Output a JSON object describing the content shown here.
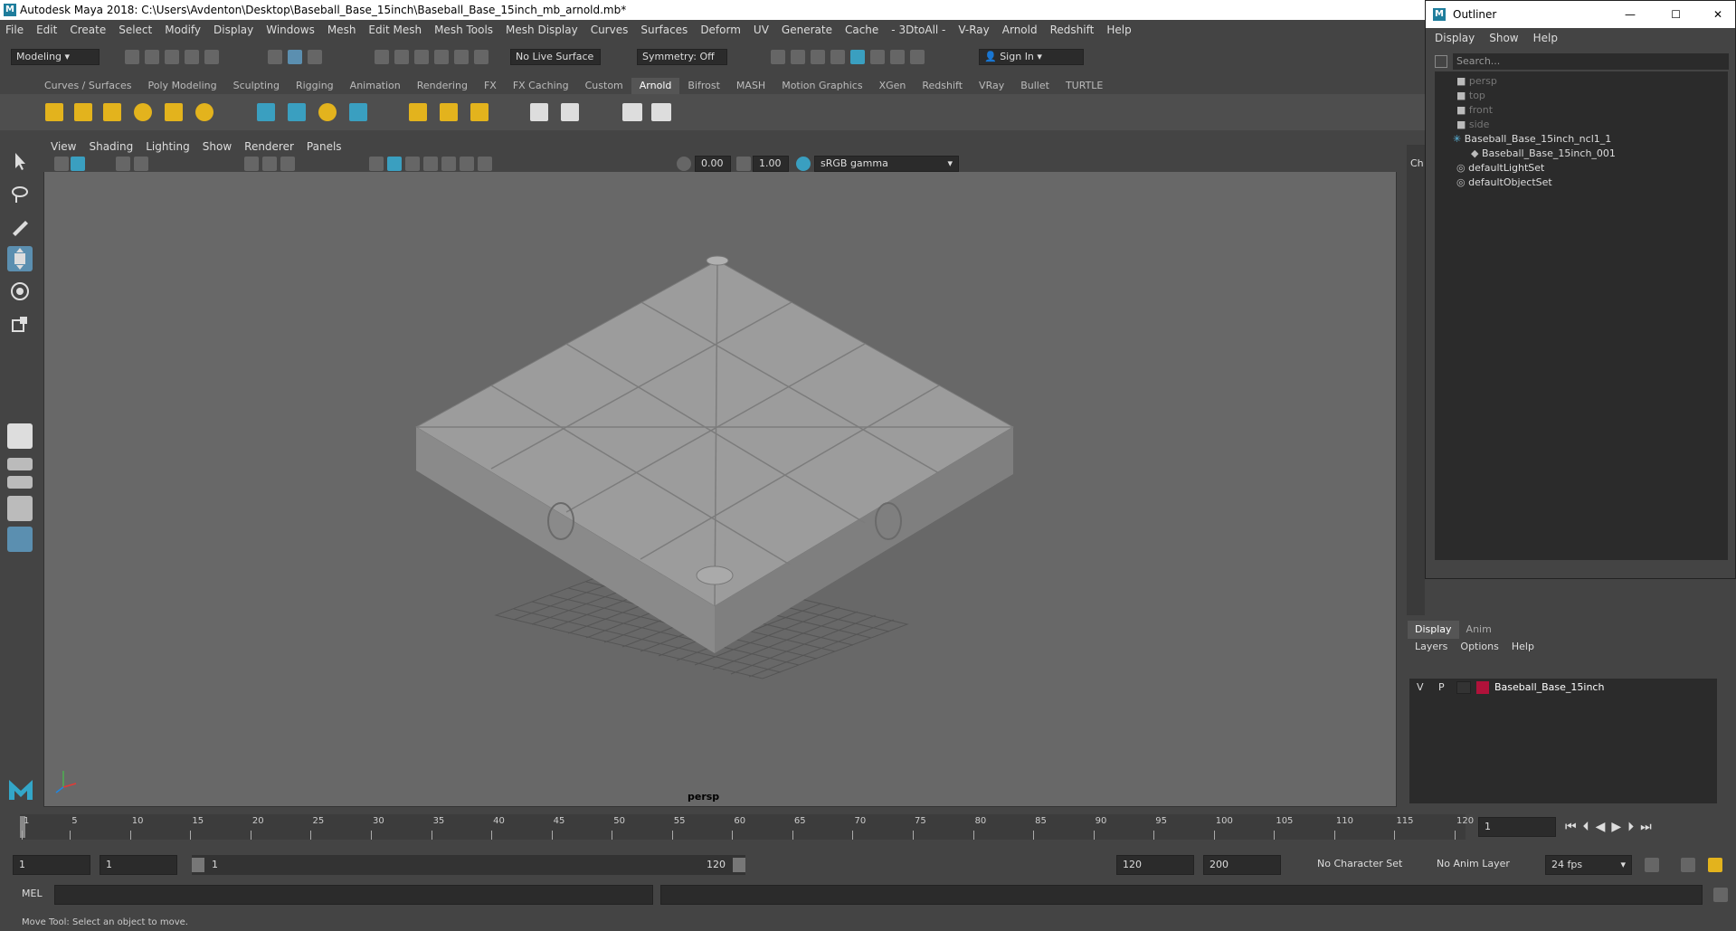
{
  "window": {
    "title": "Autodesk Maya 2018: C:\\Users\\Avdenton\\Desktop\\Baseball_Base_15inch\\Baseball_Base_15inch_mb_arnold.mb*"
  },
  "menu": [
    "File",
    "Edit",
    "Create",
    "Select",
    "Modify",
    "Display",
    "Windows",
    "Mesh",
    "Edit Mesh",
    "Mesh Tools",
    "Mesh Display",
    "Curves",
    "Surfaces",
    "Deform",
    "UV",
    "Generate",
    "Cache",
    "- 3DtoAll -",
    "V-Ray",
    "Arnold",
    "Redshift",
    "Help"
  ],
  "status": {
    "mode": "Modeling",
    "live_surface": "No Live Surface",
    "symmetry": "Symmetry: Off",
    "sign_in": "Sign In"
  },
  "shelf_tabs": [
    "Curves / Surfaces",
    "Poly Modeling",
    "Sculpting",
    "Rigging",
    "Animation",
    "Rendering",
    "FX",
    "FX Caching",
    "Custom",
    "Arnold",
    "Bifrost",
    "MASH",
    "Motion Graphics",
    "XGen",
    "Redshift",
    "VRay",
    "Bullet",
    "TURTLE"
  ],
  "shelf_active": "Arnold",
  "viewport": {
    "menu": [
      "View",
      "Shading",
      "Lighting",
      "Show",
      "Renderer",
      "Panels"
    ],
    "exposure": "0.00",
    "gamma": "1.00",
    "color_space": "sRGB gamma",
    "camera": "persp"
  },
  "outliner": {
    "title": "Outliner",
    "menu": [
      "Display",
      "Show",
      "Help"
    ],
    "search_placeholder": "Search...",
    "items": [
      {
        "label": "persp",
        "dim": true
      },
      {
        "label": "top",
        "dim": true
      },
      {
        "label": "front",
        "dim": true
      },
      {
        "label": "side",
        "dim": true
      },
      {
        "label": "Baseball_Base_15inch_ncl1_1",
        "dim": false
      },
      {
        "label": "Baseball_Base_15inch_001",
        "dim": false
      },
      {
        "label": "defaultLightSet",
        "dim": false
      },
      {
        "label": "defaultObjectSet",
        "dim": false
      }
    ]
  },
  "channel_box_tab": "Ch",
  "layer_editor": {
    "tabs": [
      "Display",
      "Anim"
    ],
    "menu": [
      "Layers",
      "Options",
      "Help"
    ],
    "layer": {
      "v": "V",
      "p": "P",
      "name": "Baseball_Base_15inch",
      "color": "#b0123a"
    }
  },
  "timeline": {
    "ticks": [
      "1",
      "5",
      "10",
      "15",
      "20",
      "25",
      "30",
      "35",
      "40",
      "45",
      "50",
      "55",
      "60",
      "65",
      "70",
      "75",
      "80",
      "85",
      "90",
      "95",
      "100",
      "105",
      "110",
      "115",
      "120"
    ],
    "current_frame": "1"
  },
  "range": {
    "start": "1",
    "inner_start": "1",
    "slider_start": "1",
    "slider_end": "120",
    "end": "120",
    "outer_end": "200",
    "character_set": "No Character Set",
    "anim_layer": "No Anim Layer",
    "fps": "24 fps"
  },
  "cmd": {
    "label": "MEL"
  },
  "help_line": "Move Tool: Select an object to move."
}
